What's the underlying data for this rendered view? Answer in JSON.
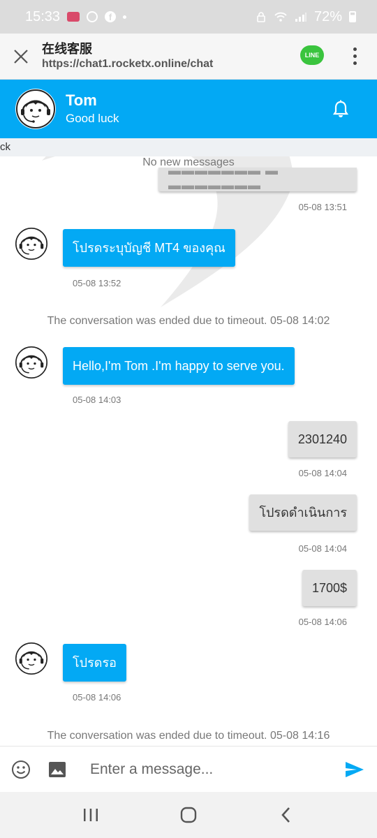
{
  "status_bar": {
    "time": "15:33",
    "battery": "72%"
  },
  "browser": {
    "title": "在线客服",
    "url": "https://chat1.rocketx.online/chat",
    "line_badge": "LINE"
  },
  "agent": {
    "name": "Tom",
    "status": "Good luck"
  },
  "banner_text": "ck",
  "no_new_messages": "No new messages",
  "messages": [
    {
      "type": "sent",
      "text": "",
      "time": "05-08 13:51"
    },
    {
      "type": "received",
      "text": "โปรดระบุบัญชี MT4 ของคุณ",
      "time": "05-08 13:52"
    },
    {
      "type": "system",
      "text": "The conversation was ended due to timeout. 05-08 14:02"
    },
    {
      "type": "received",
      "text": "Hello,I'm Tom .I'm happy to serve you.",
      "time": "05-08 14:03"
    },
    {
      "type": "sent",
      "text": "2301240",
      "time": "05-08 14:04"
    },
    {
      "type": "sent",
      "text": "โปรดดำเนินการ",
      "time": "05-08 14:04"
    },
    {
      "type": "sent",
      "text": "1700$",
      "time": "05-08 14:06"
    },
    {
      "type": "received",
      "text": "โปรดรอ",
      "time": "05-08 14:06"
    },
    {
      "type": "system",
      "text": "The conversation was ended due to timeout. 05-08 14:16"
    }
  ],
  "composer": {
    "placeholder": "Enter a message..."
  },
  "colors": {
    "accent": "#03a9f4",
    "sent_bubble": "#e0e0e0",
    "line_green": "#3ac43e"
  }
}
